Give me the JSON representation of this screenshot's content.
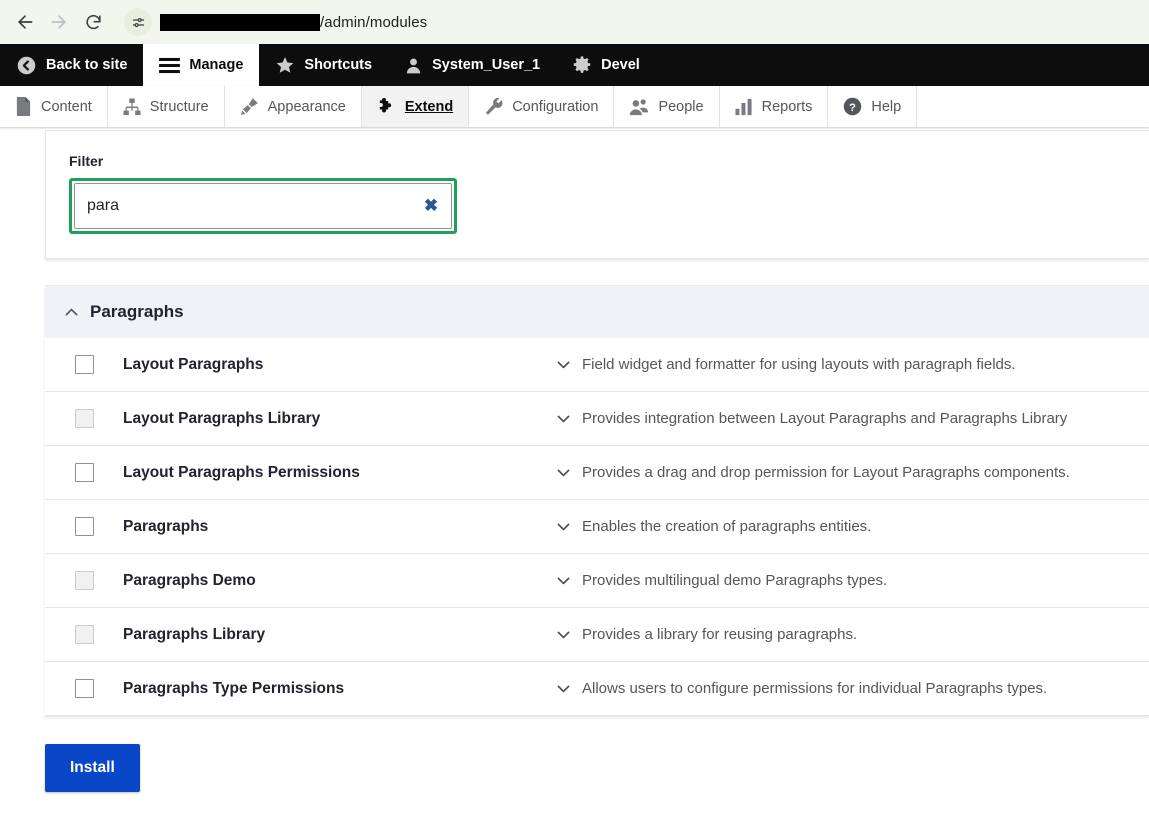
{
  "browser": {
    "back_label": "Back",
    "forward_label": "Forward",
    "reload_label": "Reload",
    "url_prefix_redacted": true,
    "url_path": "/admin/modules",
    "site_info_icon": "site-settings-icon"
  },
  "admin_toolbar": {
    "items": [
      {
        "label": "Back to site",
        "icon": "back-arrow-icon",
        "active": false
      },
      {
        "label": "Manage",
        "icon": "hamburger-icon",
        "active": true
      },
      {
        "label": "Shortcuts",
        "icon": "star-icon",
        "active": false
      },
      {
        "label": "System_User_1",
        "icon": "user-icon",
        "active": false
      },
      {
        "label": "Devel",
        "icon": "gear-icon",
        "active": false
      }
    ]
  },
  "admin_tabs": {
    "items": [
      {
        "label": "Content",
        "icon": "document-icon",
        "active": false
      },
      {
        "label": "Structure",
        "icon": "structure-icon",
        "active": false
      },
      {
        "label": "Appearance",
        "icon": "paintbrush-icon",
        "active": false
      },
      {
        "label": "Extend",
        "icon": "puzzle-icon",
        "active": true
      },
      {
        "label": "Configuration",
        "icon": "wrench-icon",
        "active": false
      },
      {
        "label": "People",
        "icon": "people-icon",
        "active": false
      },
      {
        "label": "Reports",
        "icon": "bar-chart-icon",
        "active": false
      },
      {
        "label": "Help",
        "icon": "question-circle-icon",
        "active": false
      }
    ]
  },
  "filter": {
    "label": "Filter",
    "value": "para",
    "placeholder": "",
    "clear_label": "✖",
    "focus_ring_color": "#20a157"
  },
  "package": {
    "title": "Paragraphs",
    "expanded": true,
    "toggle_icon": "chevron-up-icon"
  },
  "modules": [
    {
      "name": "Layout Paragraphs",
      "description": "Field widget and formatter for using layouts with paragraph fields.",
      "checked": false,
      "disabled": false
    },
    {
      "name": "Layout Paragraphs Library",
      "description": "Provides integration between Layout Paragraphs and Paragraphs Library",
      "checked": false,
      "disabled": true
    },
    {
      "name": "Layout Paragraphs Permissions",
      "description": "Provides a drag and drop permission for Layout Paragraphs components.",
      "checked": false,
      "disabled": false
    },
    {
      "name": "Paragraphs",
      "description": "Enables the creation of paragraphs entities.",
      "checked": false,
      "disabled": false
    },
    {
      "name": "Paragraphs Demo",
      "description": "Provides multilingual demo Paragraphs types.",
      "checked": false,
      "disabled": true
    },
    {
      "name": "Paragraphs Library",
      "description": "Provides a library for reusing paragraphs.",
      "checked": false,
      "disabled": true
    },
    {
      "name": "Paragraphs Type Permissions",
      "description": "Allows users to configure permissions for individual Paragraphs types.",
      "checked": false,
      "disabled": false
    }
  ],
  "actions": {
    "install_label": "Install",
    "install_color": "#0a46c8"
  }
}
